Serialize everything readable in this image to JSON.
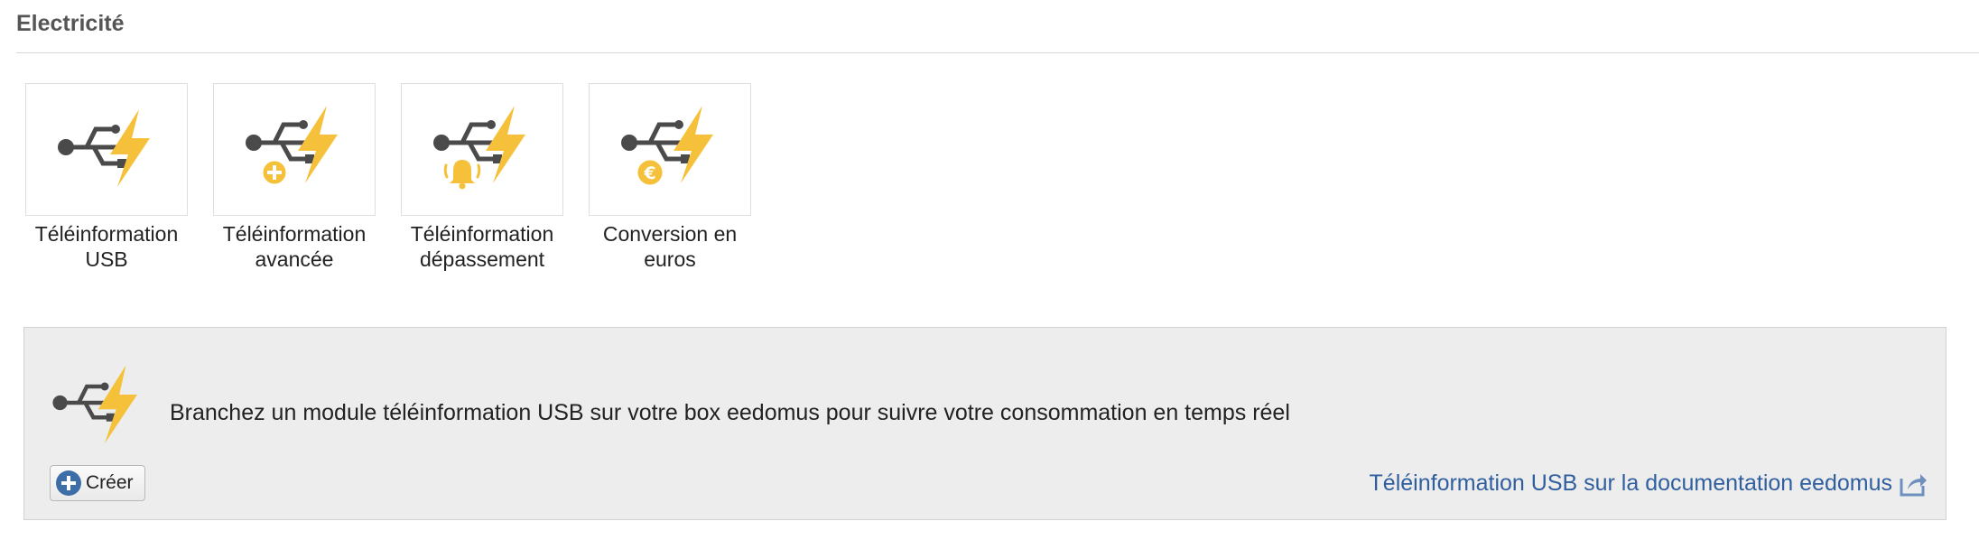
{
  "section": {
    "title": "Electricité"
  },
  "tiles": [
    {
      "label": "Téléinformation\nUSB",
      "icon": "usb-lightning-icon"
    },
    {
      "label": "Téléinformation\navancée",
      "icon": "usb-lightning-plus-icon"
    },
    {
      "label": "Téléinformation\ndépassement",
      "icon": "usb-lightning-bell-icon"
    },
    {
      "label": "Conversion en\neuros",
      "icon": "usb-lightning-euro-icon"
    }
  ],
  "panel": {
    "icon": "usb-lightning-icon",
    "description": "Branchez un module téléinformation USB sur votre box eedomus pour suivre votre consommation en temps réel",
    "create_label": "Créer",
    "doc_link_label": "Téléinformation USB sur la documentation eedomus"
  },
  "colors": {
    "lightning": "#f5c13a",
    "usb_gray": "#4a4a4a",
    "link": "#2f5f9f",
    "panel_bg": "#ededed",
    "button_plus": "#3d6ea8"
  }
}
